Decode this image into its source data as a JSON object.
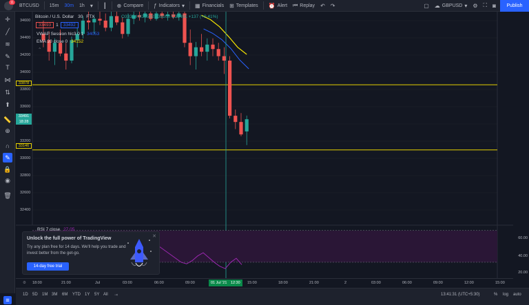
{
  "topbar": {
    "notif_count": "11",
    "symbol": "BTCUSD",
    "intervals": [
      "15m",
      "30m",
      "1h"
    ],
    "active_interval": "30m",
    "compare_label": "Compare",
    "indicators_label": "Indicators",
    "financials_label": "Financials",
    "templates_label": "Templates",
    "alert_label": "Alert",
    "replay_label": "Replay",
    "account_label": "GBPUSD",
    "publish_label": "Publish"
  },
  "legend": {
    "title": "Bitcoin / U.S. Dollar",
    "interval": "30",
    "exchange": "FTX",
    "ohlc": "O33354 H33532 L33200 C33491 +137 (+0.41%)",
    "sell_price": "33493",
    "spread": "1",
    "buy_price": "33492",
    "vwap_label": "VWAP Session hlc3 0 1",
    "vwap_value": "34053",
    "ema_label": "EMA 20 close 0",
    "ema_value": "34152"
  },
  "price_scale": {
    "labels": [
      "34600",
      "34400",
      "34200",
      "34000",
      "33800",
      "33600",
      "33400",
      "33200",
      "33000",
      "32800",
      "32600",
      "32400"
    ],
    "tag_upper": "33878",
    "tag_current": "33491",
    "tag_current_time": "18:28",
    "tag_lower": "33146"
  },
  "rsi": {
    "label": "RSI 7 close",
    "value": "27.05",
    "scale": [
      "60.00",
      "40.00",
      "20.00"
    ]
  },
  "time_axis": {
    "labels": [
      "18:00",
      "21:00",
      "Jul",
      "03:00",
      "06:00",
      "09:00",
      "15:00",
      "18:00",
      "21:00",
      "2",
      "03:00",
      "06:00",
      "09:00",
      "12:00",
      "15:00"
    ],
    "current": "01 Jul '21",
    "current_time": "12:30"
  },
  "bottom_bar": {
    "ranges": [
      "1D",
      "5D",
      "1M",
      "3M",
      "6M",
      "YTD",
      "1Y",
      "5Y",
      "All"
    ],
    "clock": "13:41:31 (UTC+5:30)",
    "percent": "%",
    "log": "log",
    "auto": "auto"
  },
  "promo": {
    "title": "Unlock the full power of TradingView",
    "text": "Try any plan free for 14 days. We'll help you trade and invest better from the get-go.",
    "button": "14-day free trial"
  },
  "colors": {
    "bull": "#26a69a",
    "bear": "#ef5350",
    "accent": "#2962ff",
    "hline": "#e8d200",
    "vwap": "#2962ff",
    "ema": "#f7e600",
    "rsi": "#9c27b0"
  },
  "chart_data": {
    "type": "candlestick",
    "ylim": [
      32300,
      34700
    ],
    "hlines": [
      33878,
      33146
    ],
    "candles": [
      {
        "o": 34450,
        "h": 34600,
        "l": 34300,
        "c": 34380
      },
      {
        "o": 34380,
        "h": 34480,
        "l": 34150,
        "c": 34250
      },
      {
        "o": 34250,
        "h": 34400,
        "l": 34100,
        "c": 34350
      },
      {
        "o": 34350,
        "h": 34500,
        "l": 34200,
        "c": 34230
      },
      {
        "o": 34230,
        "h": 34350,
        "l": 34050,
        "c": 34150
      },
      {
        "o": 34150,
        "h": 34420,
        "l": 34120,
        "c": 34380
      },
      {
        "o": 34380,
        "h": 34520,
        "l": 34300,
        "c": 34450
      },
      {
        "o": 34450,
        "h": 34650,
        "l": 34400,
        "c": 34600
      },
      {
        "o": 34600,
        "h": 34700,
        "l": 34500,
        "c": 34580
      },
      {
        "o": 34580,
        "h": 34650,
        "l": 34450,
        "c": 34620
      },
      {
        "o": 34620,
        "h": 34700,
        "l": 34550,
        "c": 34600
      },
      {
        "o": 34600,
        "h": 34680,
        "l": 34480,
        "c": 34520
      },
      {
        "o": 34520,
        "h": 34700,
        "l": 34480,
        "c": 34650
      },
      {
        "o": 34650,
        "h": 34700,
        "l": 34550,
        "c": 34580
      },
      {
        "o": 34580,
        "h": 34640,
        "l": 34400,
        "c": 34450
      },
      {
        "o": 34450,
        "h": 34680,
        "l": 34420,
        "c": 34620
      },
      {
        "o": 34620,
        "h": 34700,
        "l": 34560,
        "c": 34660
      },
      {
        "o": 34660,
        "h": 34700,
        "l": 34600,
        "c": 34640
      },
      {
        "o": 34640,
        "h": 34700,
        "l": 34580,
        "c": 34680
      },
      {
        "o": 34680,
        "h": 34700,
        "l": 34600,
        "c": 34620
      },
      {
        "o": 34620,
        "h": 34700,
        "l": 34600,
        "c": 34680
      },
      {
        "o": 34680,
        "h": 34700,
        "l": 34620,
        "c": 34650
      },
      {
        "o": 34650,
        "h": 34700,
        "l": 34600,
        "c": 34670
      },
      {
        "o": 34670,
        "h": 34700,
        "l": 34620,
        "c": 34640
      },
      {
        "o": 34640,
        "h": 34700,
        "l": 34600,
        "c": 34680
      },
      {
        "o": 34680,
        "h": 34700,
        "l": 34300,
        "c": 34350
      },
      {
        "o": 34350,
        "h": 34500,
        "l": 34100,
        "c": 34200
      },
      {
        "o": 34200,
        "h": 34360,
        "l": 34050,
        "c": 34300
      },
      {
        "o": 34300,
        "h": 34450,
        "l": 34200,
        "c": 34250
      },
      {
        "o": 34250,
        "h": 34400,
        "l": 34150,
        "c": 34330
      },
      {
        "o": 34330,
        "h": 34400,
        "l": 34200,
        "c": 34280
      },
      {
        "o": 34280,
        "h": 34350,
        "l": 34150,
        "c": 34200
      },
      {
        "o": 34200,
        "h": 34300,
        "l": 34000,
        "c": 34150
      },
      {
        "o": 34150,
        "h": 34200,
        "l": 33500,
        "c": 33530
      },
      {
        "o": 33530,
        "h": 33600,
        "l": 33380,
        "c": 33460
      },
      {
        "o": 33460,
        "h": 33560,
        "l": 33300,
        "c": 33320
      },
      {
        "o": 33354,
        "h": 33532,
        "l": 33200,
        "c": 33491
      }
    ],
    "first_candle_x": 40,
    "candle_spacing": 8.2,
    "ema": [
      34660,
      34610,
      34530,
      34420,
      34300,
      34220
    ],
    "vwap": [
      34600,
      34550,
      34480,
      34380,
      34250,
      34150
    ],
    "rsi_values": [
      55,
      50,
      45,
      40,
      35,
      30,
      28,
      32,
      38,
      42,
      36,
      30,
      25,
      22,
      30,
      35,
      27
    ],
    "rsi_levels": [
      70,
      30
    ],
    "rsi_ylim": [
      10,
      75
    ]
  }
}
